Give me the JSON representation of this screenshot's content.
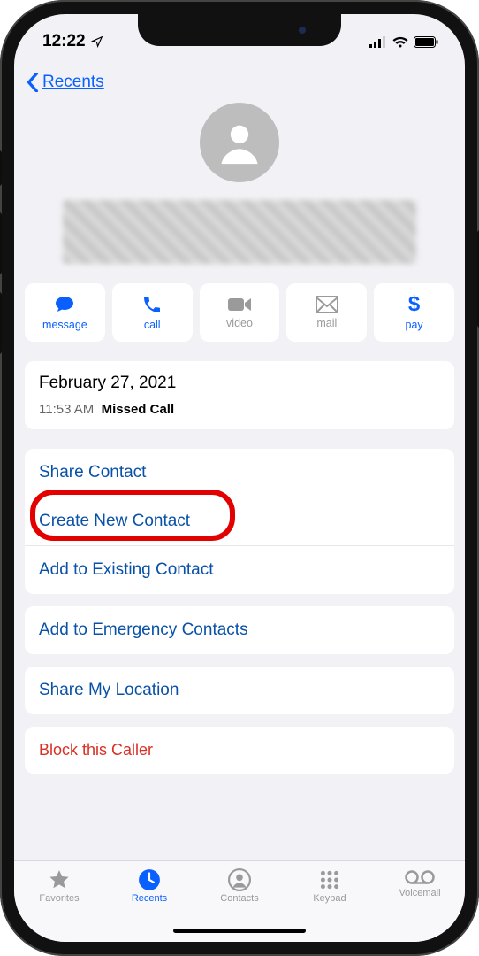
{
  "status": {
    "time": "12:22"
  },
  "nav": {
    "back_label": "Recents"
  },
  "actions": {
    "message": "message",
    "call": "call",
    "video": "video",
    "mail": "mail",
    "pay_symbol": "$",
    "pay": "pay"
  },
  "call_detail": {
    "date": "February 27, 2021",
    "time": "11:53 AM",
    "status": "Missed Call"
  },
  "options": {
    "share_contact": "Share Contact",
    "create_new_contact": "Create New Contact",
    "add_existing": "Add to Existing Contact",
    "add_emergency": "Add to Emergency Contacts",
    "share_location": "Share My Location",
    "block": "Block this Caller"
  },
  "tabs": {
    "favorites": "Favorites",
    "recents": "Recents",
    "contacts": "Contacts",
    "keypad": "Keypad",
    "voicemail": "Voicemail"
  }
}
